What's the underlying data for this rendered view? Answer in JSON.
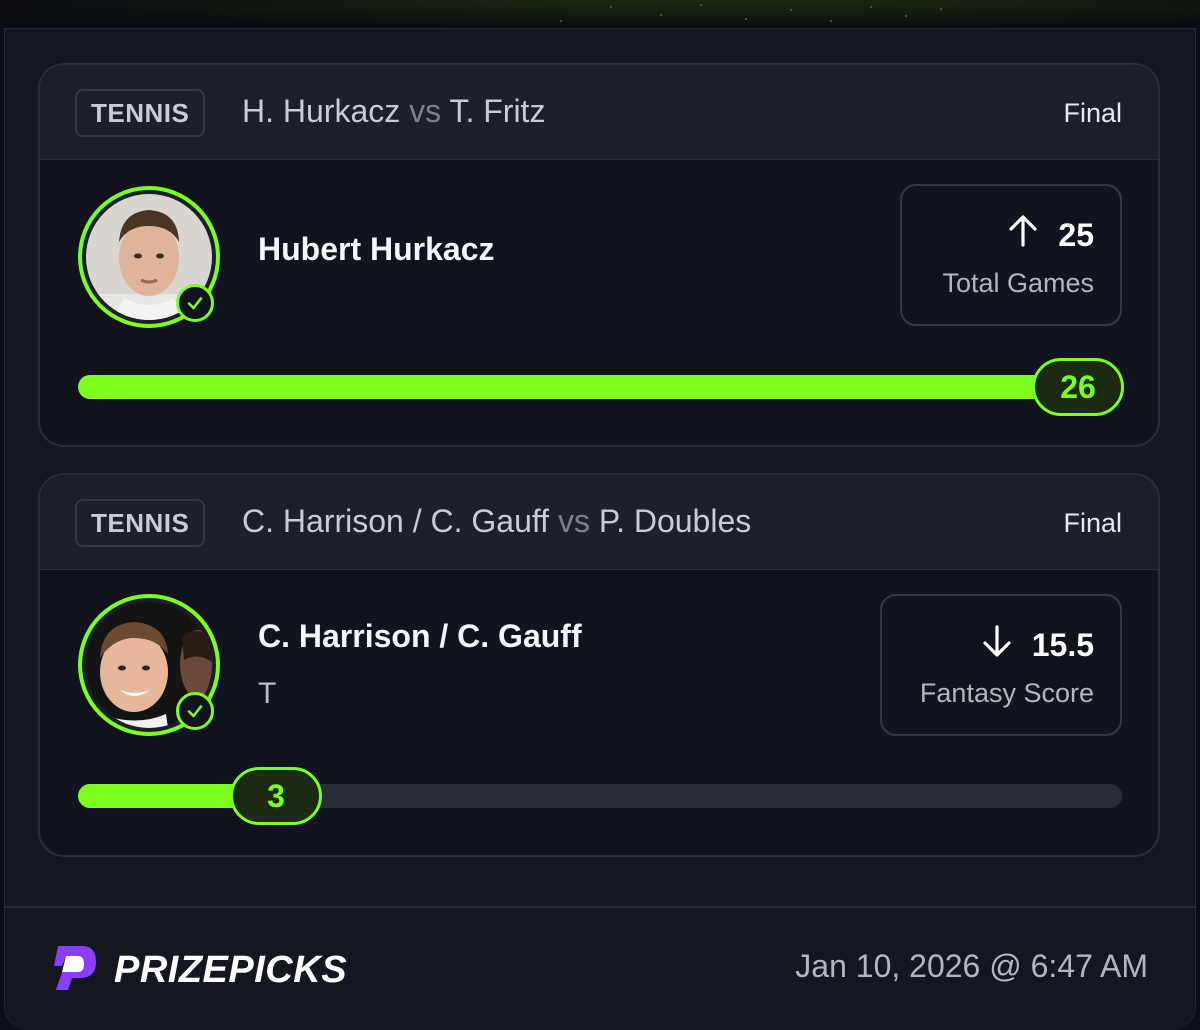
{
  "picks": [
    {
      "sport": "TENNIS",
      "matchup_a": "H. Hurkacz",
      "vs": "vs",
      "matchup_b": "T. Fritz",
      "status": "Final",
      "player": "Hubert Hurkacz",
      "player_sub": "",
      "direction": "up",
      "line": "25",
      "stat": "Total Games",
      "result": "26",
      "progress": 1.0
    },
    {
      "sport": "TENNIS",
      "matchup_a": "C. Harrison / C. Gauff",
      "vs": "vs",
      "matchup_b": "P. Doubles",
      "status": "Final",
      "player": "C. Harrison / C. Gauff",
      "player_sub": "T",
      "direction": "down",
      "line": "15.5",
      "stat": "Fantasy Score",
      "result": "3",
      "progress": 0.19
    }
  ],
  "footer": {
    "brand": "PRIZEPICKS",
    "timestamp": "Jan 10, 2026 @ 6:47 AM"
  },
  "colors": {
    "accent": "#7cff1e",
    "brand": "#8b3dff",
    "background": "#141620"
  }
}
